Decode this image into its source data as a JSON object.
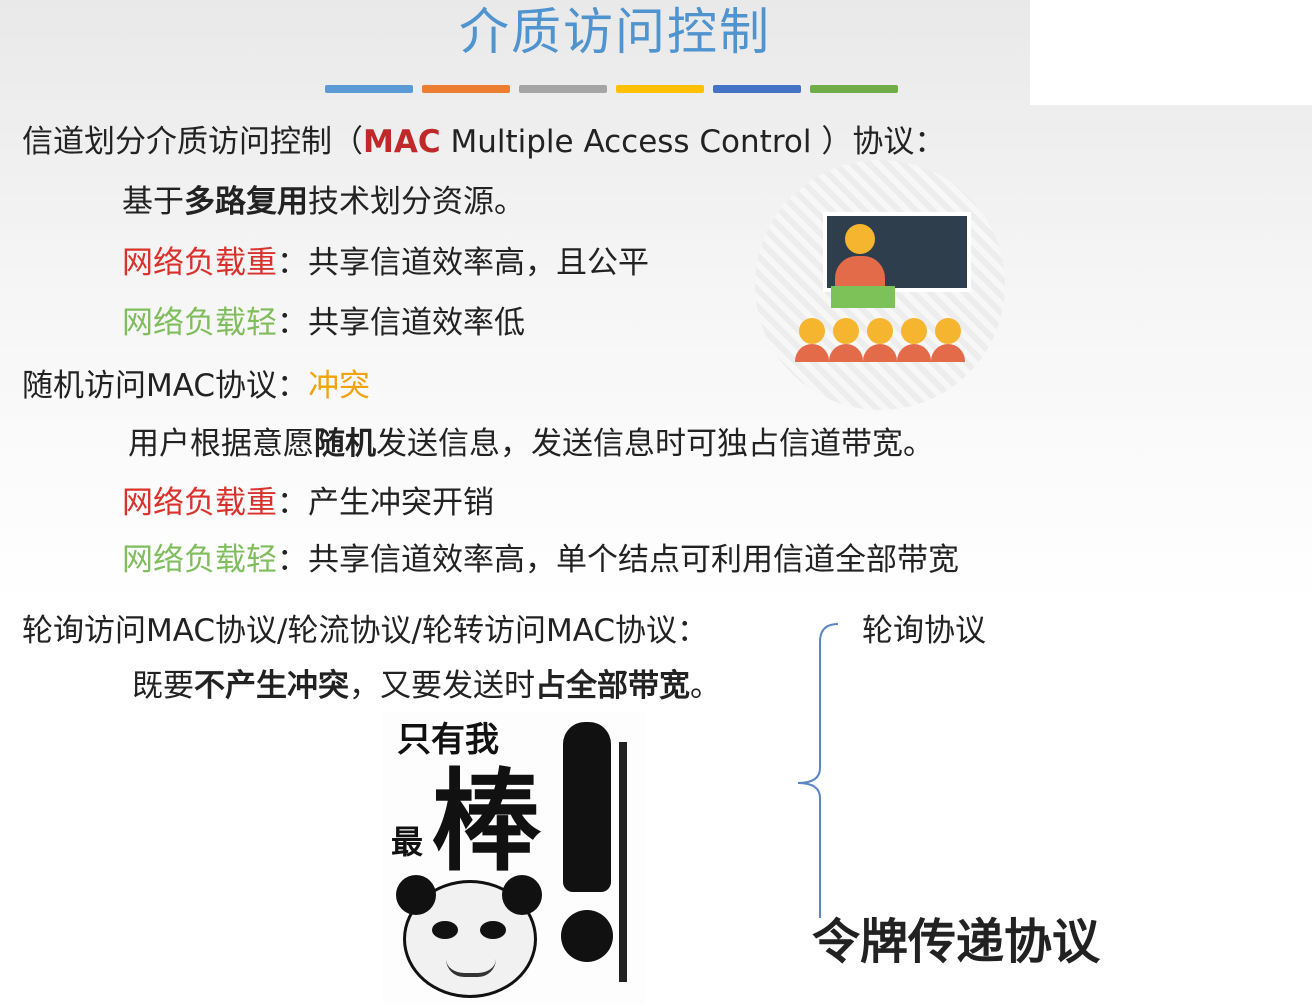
{
  "slide": {
    "title": "介质访问控制",
    "title_bar_colors": [
      "#5b9bd5",
      "#ed7d31",
      "#a5a5a5",
      "#ffc000",
      "#4472c4",
      "#70ad47"
    ]
  },
  "section1": {
    "heading_prefix": "信道划分介质访问控制（",
    "heading_mac": "MAC",
    "heading_mid": " Multiple Access Control ）协议：",
    "desc_prefix": "基于",
    "desc_bold": "多路复用",
    "desc_suffix": "技术划分资源。",
    "heavy_label": "网络负载重",
    "heavy_text": "：共享信道效率高，且公平",
    "light_label": "网络负载轻",
    "light_text": "：共享信道效率低"
  },
  "section2": {
    "heading": "随机访问MAC协议：",
    "heading_highlight": "冲突",
    "desc_prefix": "用户根据意愿",
    "desc_bold": "随机",
    "desc_suffix": "发送信息，发送信息时可独占信道带宽。",
    "heavy_label": "网络负载重",
    "heavy_text": "：产生冲突开销",
    "light_label": "网络负载轻",
    "light_text": "：共享信道效率高，单个结点可利用信道全部带宽"
  },
  "section3": {
    "heading": "轮询访问MAC协议/轮流协议/轮转访问MAC协议：",
    "desc_prefix": "既要",
    "desc_bold1": "不产生冲突",
    "desc_mid": "，又要发送时",
    "desc_bold2": "占全部带宽",
    "desc_suffix": "。"
  },
  "brace": {
    "top_label": "轮询协议",
    "bottom_label": "令牌传递协议"
  },
  "meme": {
    "text_top": "只有我",
    "text_small": "最",
    "text_big": "棒"
  },
  "colors": {
    "title": "#4f93cf",
    "heavy": "#d9322c",
    "light": "#7fbd5d",
    "conflict": "#f2a20c",
    "mac": "#c0282a"
  }
}
